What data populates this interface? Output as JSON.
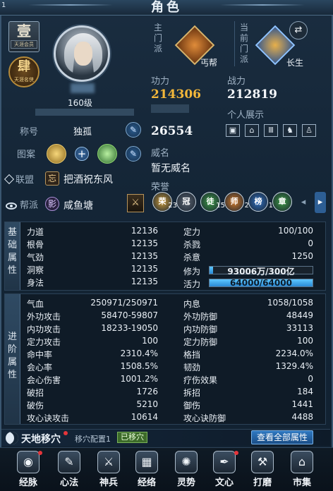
{
  "window": {
    "title": "角色",
    "corner_mark": "1"
  },
  "badges": {
    "vip": {
      "char": "壹",
      "text": "天涯会员"
    },
    "rank": {
      "char": "肆",
      "text": "天涯名侠"
    }
  },
  "player": {
    "level": "160级"
  },
  "title_row": {
    "label": "称号",
    "value": "独孤"
  },
  "pattern_row": {
    "label": "图案"
  },
  "alliance_row": {
    "label": "联盟",
    "seal": "忘",
    "value": "把酒祝东风"
  },
  "faction_row": {
    "label": "帮派",
    "seal": "影",
    "value": "咸鱼塘"
  },
  "sect": {
    "main_label": "主门派",
    "main_name": "丐帮",
    "current_label": "当前门派",
    "current_name": "长生"
  },
  "stats": {
    "gongli_label": "功力",
    "gongli_value": "214306",
    "zhanli_label": "战力",
    "zhanli_value": "212819",
    "extra_value": "26554",
    "showcase_label": "个人展示",
    "weiming_label": "威名",
    "weiming_value": "暂无威名",
    "honor_label": "荣誉"
  },
  "honors": [
    {
      "glyph": "荣",
      "count": "23",
      "color": "#c89a3a"
    },
    {
      "glyph": "冠",
      "count": "",
      "color": "#5a6470"
    },
    {
      "glyph": "徒",
      "count": "15",
      "color": "#3c9a45"
    },
    {
      "glyph": "师",
      "count": "2",
      "color": "#d27a2a"
    },
    {
      "glyph": "榜",
      "count": "1",
      "color": "#2f6fc0"
    },
    {
      "glyph": "章",
      "count": "",
      "color": "#3c9a45"
    }
  ],
  "basic_attrs": {
    "side_label": [
      "基",
      "础",
      "属",
      "性"
    ],
    "left": [
      {
        "name": "力道",
        "value": "12136"
      },
      {
        "name": "根骨",
        "value": "12135"
      },
      {
        "name": "气劲",
        "value": "12135"
      },
      {
        "name": "洞察",
        "value": "12135"
      },
      {
        "name": "身法",
        "value": "12135"
      }
    ],
    "right": [
      {
        "name": "定力",
        "value": "100/100"
      },
      {
        "name": "杀戮",
        "value": "0"
      },
      {
        "name": "杀意",
        "value": "1250"
      }
    ],
    "xiuwei": {
      "name": "修为",
      "text": "93006万/300亿",
      "fill": 0.031
    },
    "huoli": {
      "name": "活力",
      "text": "64000/64000",
      "fill": 1.0
    }
  },
  "advanced_attrs": {
    "side_label": [
      "进",
      "阶",
      "属",
      "性"
    ],
    "left": [
      {
        "name": "气血",
        "value": "250971/250971"
      },
      {
        "name": "外功攻击",
        "value": "58470-59807"
      },
      {
        "name": "内功攻击",
        "value": "18233-19050"
      },
      {
        "name": "定力攻击",
        "value": "100"
      },
      {
        "name": "命中率",
        "value": "2310.4%"
      },
      {
        "name": "会心率",
        "value": "1508.5%"
      },
      {
        "name": "会心伤害",
        "value": "1001.2%"
      },
      {
        "name": "破招",
        "value": "1726"
      },
      {
        "name": "破伤",
        "value": "5210"
      },
      {
        "name": "攻心诀攻击",
        "value": "10614"
      }
    ],
    "right": [
      {
        "name": "内息",
        "value": "1058/1058"
      },
      {
        "name": "外功防御",
        "value": "48449"
      },
      {
        "name": "内功防御",
        "value": "33113"
      },
      {
        "name": "定力防御",
        "value": "100"
      },
      {
        "name": "格挡",
        "value": "2234.0%"
      },
      {
        "name": "韧劲",
        "value": "1329.4%"
      },
      {
        "name": "疗伤效果",
        "value": "0"
      },
      {
        "name": "拆招",
        "value": "184"
      },
      {
        "name": "御伤",
        "value": "1441"
      },
      {
        "name": "攻心诀防御",
        "value": "4488"
      }
    ]
  },
  "relocate": {
    "name": "天地移穴",
    "config": "移穴配置1",
    "status": "已移穴",
    "view_all": "查看全部属性"
  },
  "toolbar": [
    {
      "label": "经脉",
      "glyph": "◉",
      "dot": true
    },
    {
      "label": "心法",
      "glyph": "✎",
      "dot": false
    },
    {
      "label": "神兵",
      "glyph": "⚔",
      "dot": false
    },
    {
      "label": "经络",
      "glyph": "▦",
      "dot": false
    },
    {
      "label": "灵势",
      "glyph": "✺",
      "dot": false
    },
    {
      "label": "文心",
      "glyph": "✒",
      "dot": true
    },
    {
      "label": "打磨",
      "glyph": "⚒",
      "dot": false
    },
    {
      "label": "市集",
      "glyph": "⌂",
      "dot": false
    }
  ]
}
